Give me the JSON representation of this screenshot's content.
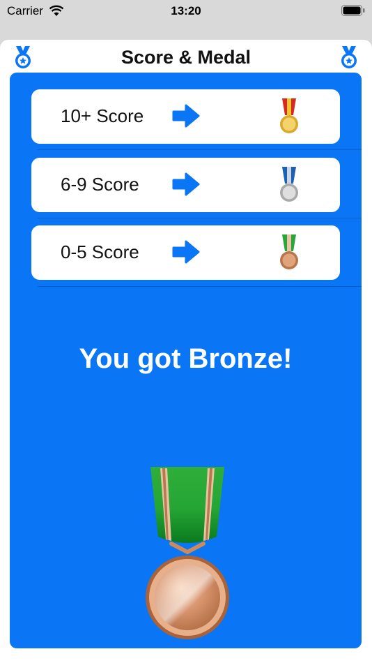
{
  "status_bar": {
    "carrier": "Carrier",
    "time": "13:20",
    "wifi_icon": "wifi-icon",
    "battery_icon": "battery-icon"
  },
  "nav": {
    "title": "Score & Medal",
    "left_icon": "medal-badge-icon",
    "right_icon": "medal-badge-icon",
    "icon_color": "#0a75f5"
  },
  "panel": {
    "background": "#0a75f5",
    "rows": [
      {
        "label": "10+ Score",
        "arrow_icon": "arrow-right-icon",
        "medal": "gold-medal-icon"
      },
      {
        "label": "6-9 Score",
        "arrow_icon": "arrow-right-icon",
        "medal": "silver-medal-icon"
      },
      {
        "label": "0-5 Score",
        "arrow_icon": "arrow-right-icon",
        "medal": "bronze-medal-icon"
      }
    ],
    "result_text": "You got Bronze!",
    "result_medal": "bronze-medal-icon"
  },
  "colors": {
    "gold": "#e2b93b",
    "silver": "#c9c9c9",
    "bronze": "#c98a5e",
    "ribbon_red": "#d52b1e",
    "ribbon_blue": "#1f5fb0",
    "ribbon_green": "#2aa53a"
  }
}
